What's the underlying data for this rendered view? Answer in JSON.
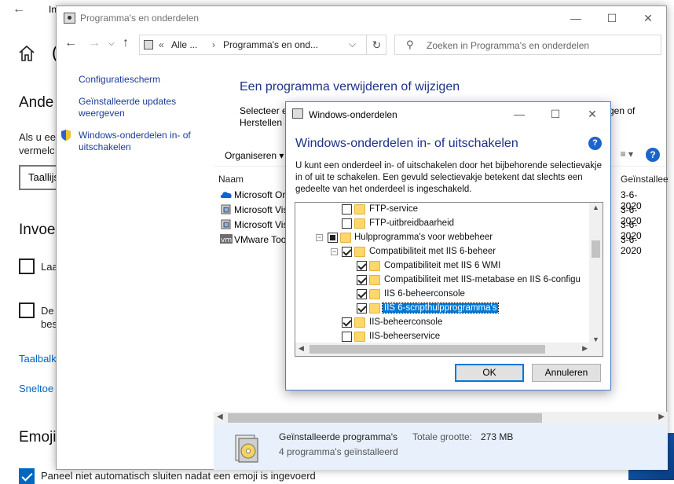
{
  "background": {
    "title_fragment": "In",
    "letter_fragment": "(",
    "heading1": "Ande",
    "para1_line1": "Als u ee",
    "para1_line2": "vermelc",
    "select_value": "Taallijs",
    "heading2": "Invoe",
    "check1_label": "Laa",
    "check2_label_line1": "De",
    "check2_label_line2": "bes",
    "link1": "Taalbalk",
    "link2": "Sneltoe",
    "heading3": "Emoji",
    "emoji_check_label": "Paneel niet automatisch sluiten nadat een emoji is ingevoerd"
  },
  "control_panel": {
    "title": "Programma's en onderdelen",
    "address": {
      "prefix": "«",
      "seg1": "Alle ...",
      "sep": "›",
      "seg2": "Programma's en ond...",
      "dropdown": "⌵",
      "refresh": "↻"
    },
    "search_placeholder": "Zoeken in Programma's en onderdelen",
    "sidebar": [
      {
        "label": "Configuratiescherm"
      },
      {
        "label": "Geïnstalleerde updates weergeven"
      },
      {
        "label": "Windows-onderdelen in- of uitschakelen"
      }
    ],
    "heading": "Een programma verwijderen of wijzigen",
    "desc_line1": "Selecteer ee",
    "desc_line2": "Herstellen a",
    "desc_right": "gen of",
    "toolbar_organize": "Organiseren ▾",
    "toolbar_view": "≡ ▾",
    "help": "?",
    "col_name": "Naam",
    "col_installed": "Geïnstallee",
    "programs": [
      {
        "name": "Microsoft Or",
        "date": "3-6-2020",
        "icon": "onedrive-icon"
      },
      {
        "name": "Microsoft Vis",
        "date": "3-6-2020",
        "icon": "installer-icon"
      },
      {
        "name": "Microsoft Vis",
        "date": "3-6-2020",
        "icon": "installer-icon"
      },
      {
        "name": "VMware Tools",
        "date": "3-6-2020",
        "icon": "vmware-icon"
      }
    ],
    "details": {
      "title": "Geïnstalleerde programma's",
      "size_label": "Totale grootte:",
      "size_value": "273 MB",
      "count": "4 programma's geïnstalleerd"
    }
  },
  "dialog": {
    "title": "Windows-onderdelen",
    "heading": "Windows-onderdelen in- of uitschakelen",
    "help": "?",
    "description": "U kunt een onderdeel in- of uitschakelen door het bijbehorende selectievakje in of uit te schakelen. Een gevuld selectievakje betekent dat slechts een gedeelte van het onderdeel is ingeschakeld.",
    "features": [
      {
        "label": "FTP-service",
        "state": "off",
        "level": 2,
        "expander": ""
      },
      {
        "label": "FTP-uitbreidbaarheid",
        "state": "off",
        "level": 2,
        "expander": ""
      },
      {
        "label": "Hulpprogramma's voor webbeheer",
        "state": "partial",
        "level": 1,
        "expander": "−"
      },
      {
        "label": "Compatibiliteit met IIS 6-beheer",
        "state": "on",
        "level": 2,
        "expander": "−"
      },
      {
        "label": "Compatibiliteit met IIS 6 WMI",
        "state": "on",
        "level": 3,
        "expander": ""
      },
      {
        "label": "Compatibiliteit met IIS-metabase en IIS 6-configu",
        "state": "on",
        "level": 3,
        "expander": ""
      },
      {
        "label": "IIS 6-beheerconsole",
        "state": "on",
        "level": 3,
        "expander": ""
      },
      {
        "label": "IIS 6-scripthulpprogramma's",
        "state": "on",
        "level": 3,
        "expander": "",
        "selected": true
      },
      {
        "label": "IIS-beheerconsole",
        "state": "on",
        "level": 2,
        "expander": ""
      },
      {
        "label": "IIS-beheerservice",
        "state": "off",
        "level": 2,
        "expander": ""
      }
    ],
    "ok_label": "OK",
    "cancel_label": "Annuleren"
  }
}
